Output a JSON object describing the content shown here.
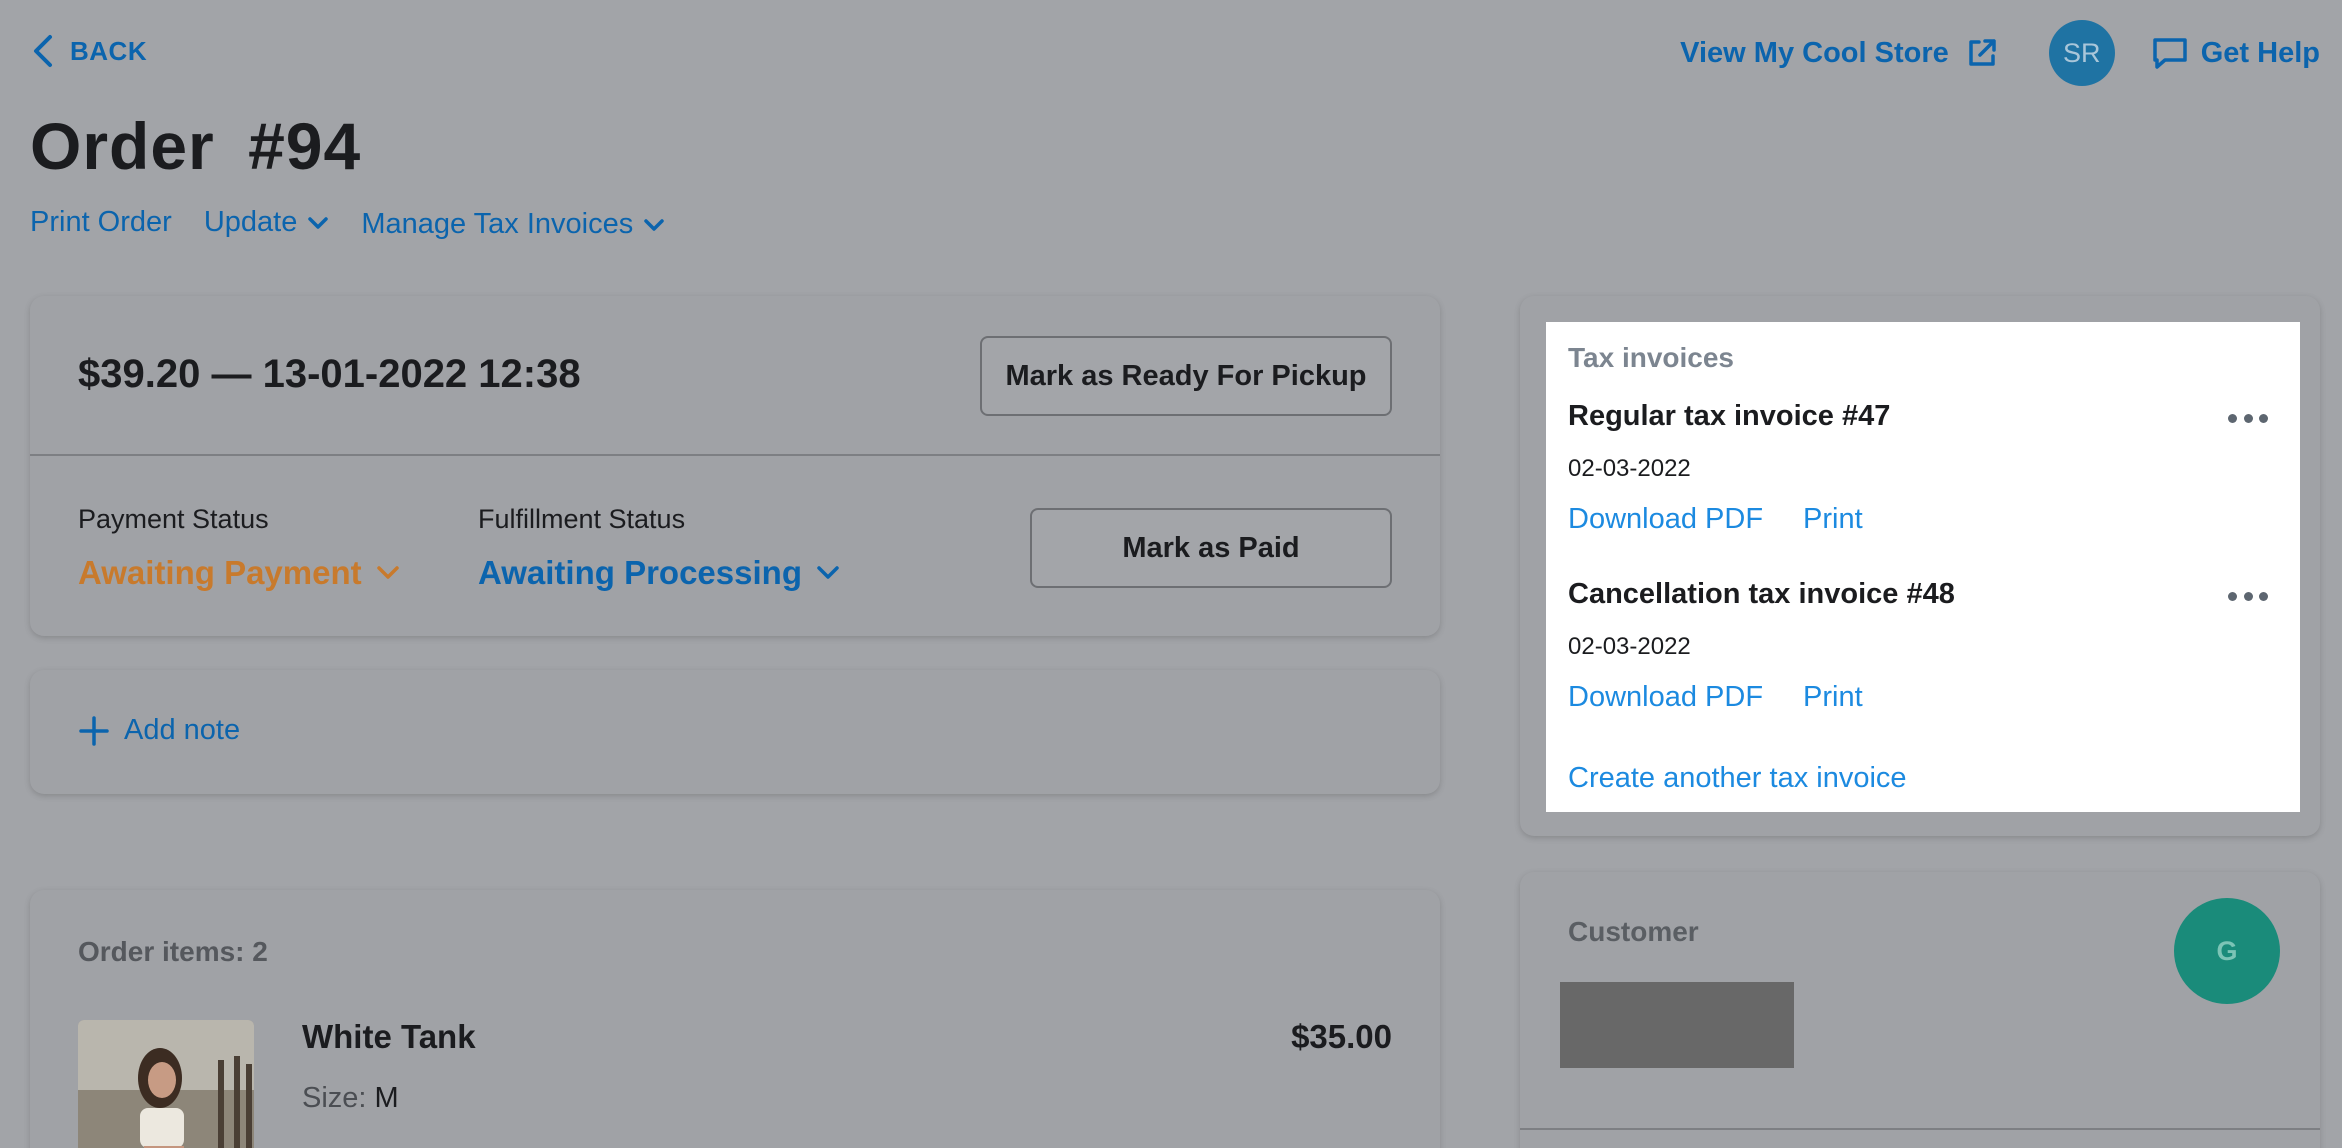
{
  "nav": {
    "back_label": "BACK",
    "store_link": "View My Cool Store",
    "user_initials": "SR",
    "help_label": "Get Help"
  },
  "page": {
    "title": "Order  #94",
    "actions": {
      "print": "Print Order",
      "update": "Update",
      "manage_tax": "Manage Tax Invoices"
    }
  },
  "order": {
    "summary": "$39.20 — 13-01-2022 12:38",
    "ready_button": "Mark as Ready For Pickup",
    "payment_status_label": "Payment Status",
    "payment_status_value": "Awaiting Payment",
    "fulfillment_status_label": "Fulfillment Status",
    "fulfillment_status_value": "Awaiting Processing",
    "paid_button": "Mark as Paid",
    "add_note": "Add note"
  },
  "items": {
    "count_label": "Order items: 2",
    "list": [
      {
        "name": "White Tank",
        "price": "$35.00",
        "size_label": "Size:",
        "size_value": "M"
      }
    ]
  },
  "tax_invoices": {
    "heading": "Tax invoices",
    "invoices": [
      {
        "title": "Regular tax invoice #47",
        "date": "02-03-2022",
        "download": "Download PDF",
        "print": "Print"
      },
      {
        "title": "Cancellation tax invoice #48",
        "date": "02-03-2022",
        "download": "Download PDF",
        "print": "Print"
      }
    ],
    "create_link": "Create another tax invoice"
  },
  "customer": {
    "heading": "Customer",
    "avatar_initial": "G"
  },
  "colors": {
    "link": "#0b64ad",
    "link_bright": "#1c8ae0",
    "awaiting_payment": "#c87a2c",
    "overlay_background": "#a2a4a8"
  },
  "icons": [
    "chevron-left-icon",
    "external-link-icon",
    "chat-icon",
    "chevron-down-icon",
    "plus-icon",
    "more-dots-icon"
  ]
}
